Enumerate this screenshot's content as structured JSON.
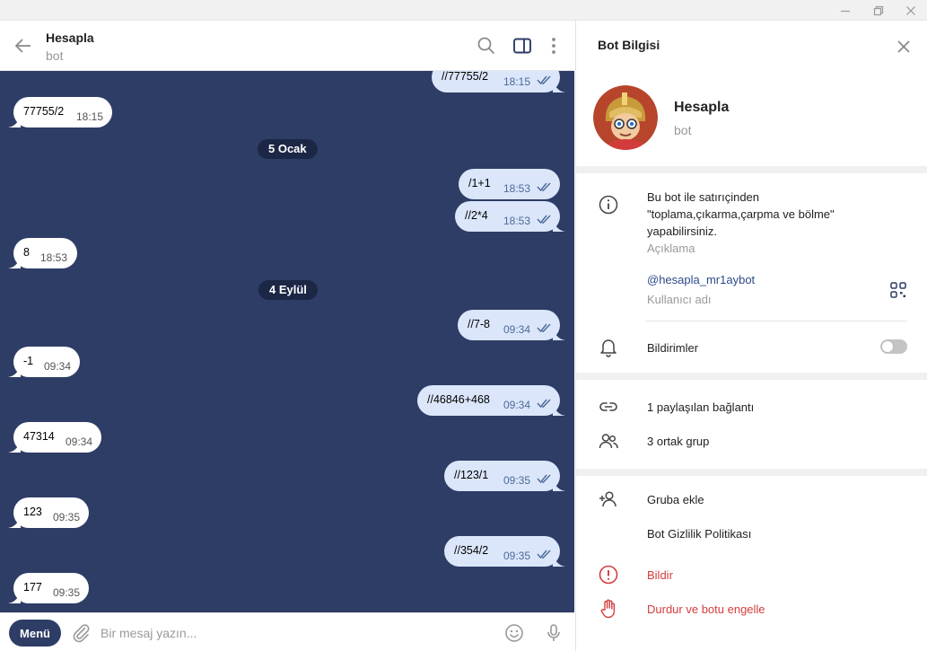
{
  "chat": {
    "title": "Hesapla",
    "subtitle": "bot"
  },
  "messages": [
    {
      "dir": "out",
      "text": "//77755/2",
      "time": "18:15"
    },
    {
      "dir": "in",
      "text": "77755/2",
      "time": "18:15"
    },
    {
      "dir": "date",
      "text": "5 Ocak"
    },
    {
      "dir": "out",
      "text": "/1+1",
      "time": "18:53"
    },
    {
      "dir": "out",
      "text": "//2*4",
      "time": "18:53"
    },
    {
      "dir": "in",
      "text": "8",
      "time": "18:53"
    },
    {
      "dir": "date",
      "text": "4 Eylül"
    },
    {
      "dir": "out",
      "text": "//7-8",
      "time": "09:34"
    },
    {
      "dir": "in",
      "text": "-1",
      "time": "09:34"
    },
    {
      "dir": "out",
      "text": "//46846+468",
      "time": "09:34"
    },
    {
      "dir": "in",
      "text": "47314",
      "time": "09:34"
    },
    {
      "dir": "out",
      "text": "//123/1",
      "time": "09:35"
    },
    {
      "dir": "in",
      "text": "123",
      "time": "09:35"
    },
    {
      "dir": "out",
      "text": "//354/2",
      "time": "09:35"
    },
    {
      "dir": "in",
      "text": "177",
      "time": "09:35"
    }
  ],
  "composer": {
    "menu_label": "Menü",
    "placeholder": "Bir mesaj yazın..."
  },
  "info": {
    "title": "Bot Bilgisi",
    "name": "Hesapla",
    "type": "bot",
    "description": "Bu bot ile satırıçinden \"toplama,çıkarma,çarpma ve bölme\" yapabilirsiniz.",
    "description_label": "Açıklama",
    "username": "@hesapla_mr1aybot",
    "username_label": "Kullanıcı adı",
    "notifications_label": "Bildirimler",
    "notifications_on": false,
    "shared_links": "1 paylaşılan bağlantı",
    "common_groups": "3 ortak grup",
    "add_to_group": "Gruba ekle",
    "privacy_policy": "Bot Gizlilik Politikası",
    "report": "Bildir",
    "stop_block": "Durdur ve botu engelle"
  },
  "colors": {
    "chat_bg": "#2e3d66",
    "outgoing_bubble": "#dbe6fb",
    "incoming_bubble": "#ffffff",
    "date_pill": "#1c2746",
    "danger": "#d33d3d",
    "link": "#2e4a8a"
  }
}
